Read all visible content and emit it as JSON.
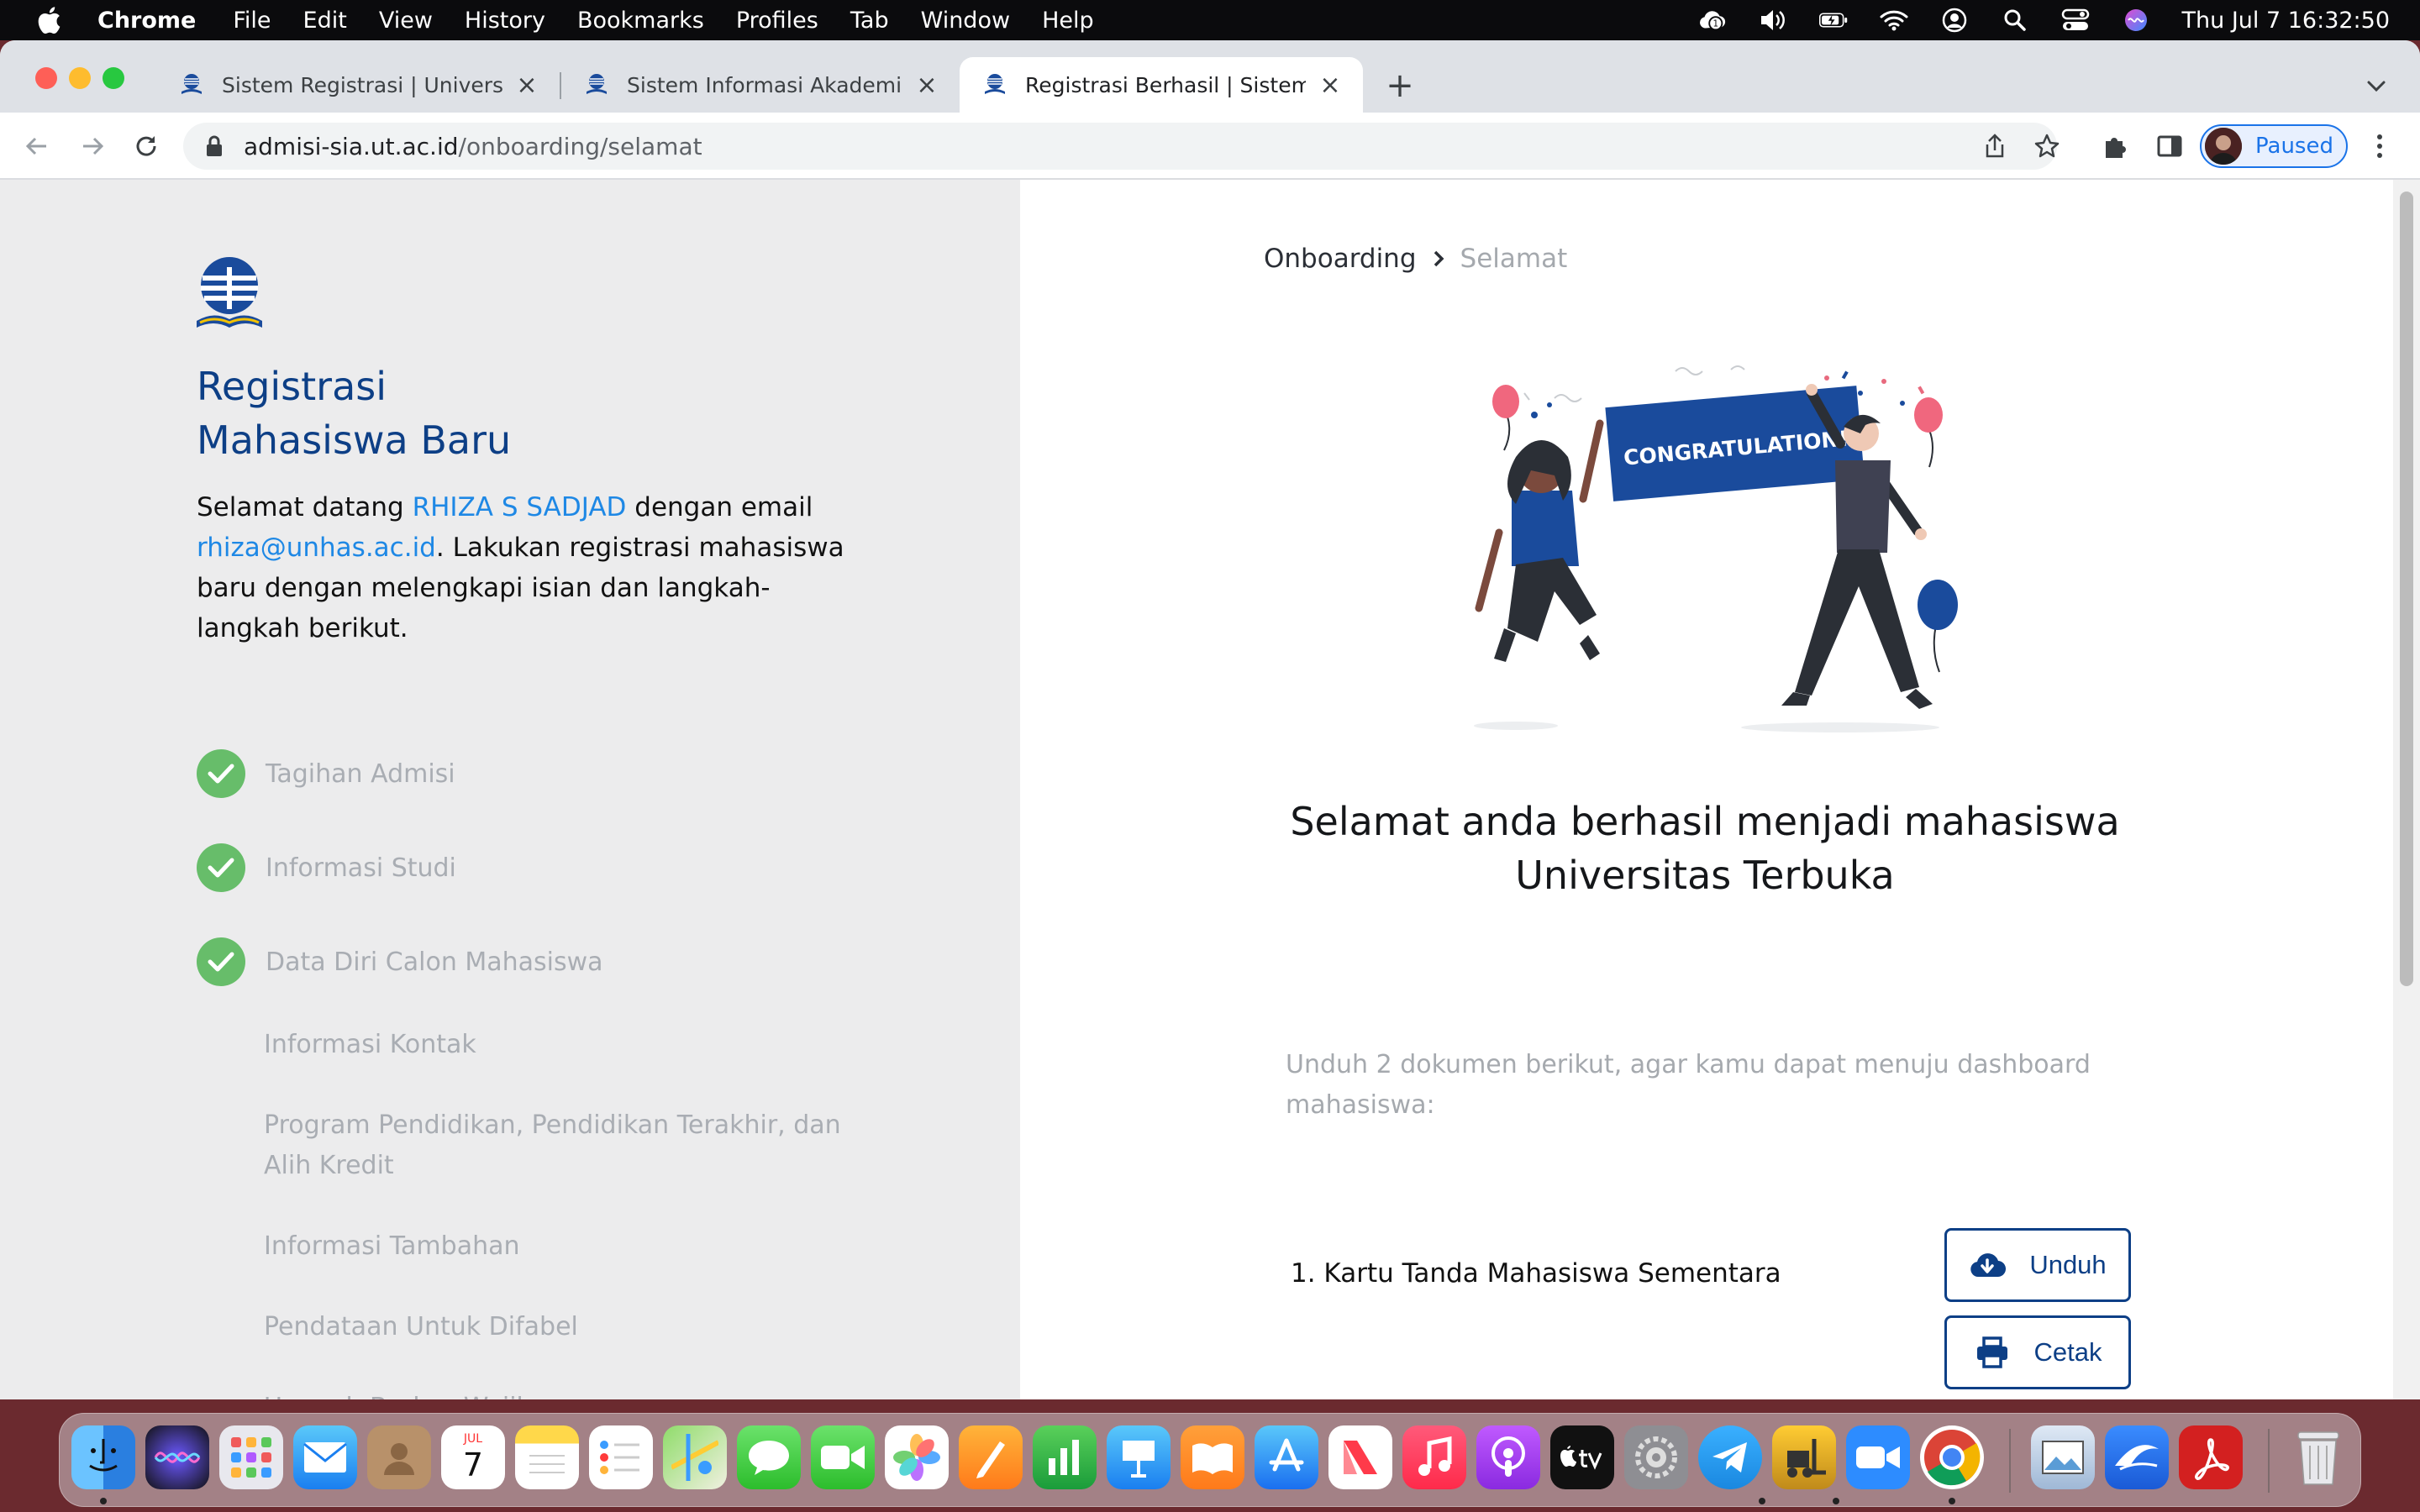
{
  "menubar": {
    "app": "Chrome",
    "items": [
      "File",
      "Edit",
      "View",
      "History",
      "Bookmarks",
      "Profiles",
      "Tab",
      "Window",
      "Help"
    ],
    "clock": "Thu Jul 7  16:32:50"
  },
  "tabs": [
    {
      "title": "Sistem Registrasi | Universitas"
    },
    {
      "title": "Sistem Informasi Akademik UT"
    },
    {
      "title": "Registrasi Berhasil | Sistem Info"
    }
  ],
  "address": {
    "host": "admisi-sia.ut.ac.id",
    "path": "/onboarding/selamat"
  },
  "profile": {
    "label": "Paused"
  },
  "sidebar": {
    "title_line1": "Registrasi",
    "title_line2": "Mahasiswa Baru",
    "welcome_prefix": "Selamat datang ",
    "user_name": "RHIZA S SADJAD",
    "welcome_mid": " dengan email ",
    "user_email": "rhiza@unhas.ac.id",
    "welcome_suffix": ". Lakukan registrasi mahasiswa baru dengan melengkapi isian dan langkah-langkah berikut.",
    "completed_steps": [
      "Tagihan Admisi",
      "Informasi Studi",
      "Data Diri Calon Mahasiswa"
    ],
    "sub_steps": [
      "Informasi Kontak",
      "Program Pendidikan, Pendidikan Terakhir, dan Alih Kredit",
      "Informasi Tambahan",
      "Pendataan Untuk Difabel",
      "Unggah Berkas Wajib"
    ]
  },
  "main": {
    "breadcrumb": [
      "Onboarding",
      "Selamat"
    ],
    "banner_text": "CONGRATULATION!",
    "title": "Selamat anda berhasil menjadi mahasiswa Universitas Terbuka",
    "instruction": "Unduh 2 dokumen berikut, agar kamu dapat menuju dashboard mahasiswa:",
    "documents": [
      {
        "label": "1. Kartu Tanda Mahasiswa Sementara"
      }
    ],
    "download_label": "Unduh",
    "print_label": "Cetak"
  },
  "colors": {
    "accent": "#0d3f86",
    "link": "#1e88e5",
    "success": "#67bd6a",
    "muted": "#a9adb3"
  },
  "dock": {
    "apps": [
      "finder-icon",
      "siri-icon",
      "launchpad-icon",
      "mail-icon",
      "contacts-icon",
      "calendar-icon",
      "notes-icon",
      "reminders-icon",
      "maps-icon",
      "messages-icon",
      "facetime-icon",
      "photos-icon",
      "pages-icon",
      "numbers-icon",
      "keynote-icon",
      "books-icon",
      "app-store-icon",
      "news-icon",
      "music-icon",
      "podcasts-icon",
      "apple-tv-icon",
      "system-preferences-icon",
      "telegram-icon",
      "forklift-icon",
      "zoom-icon",
      "chrome-icon",
      "preview-icon",
      "mail-client-icon",
      "acrobat-icon",
      "trash-icon"
    ],
    "calendar_month": "JUL",
    "calendar_day": "7"
  }
}
